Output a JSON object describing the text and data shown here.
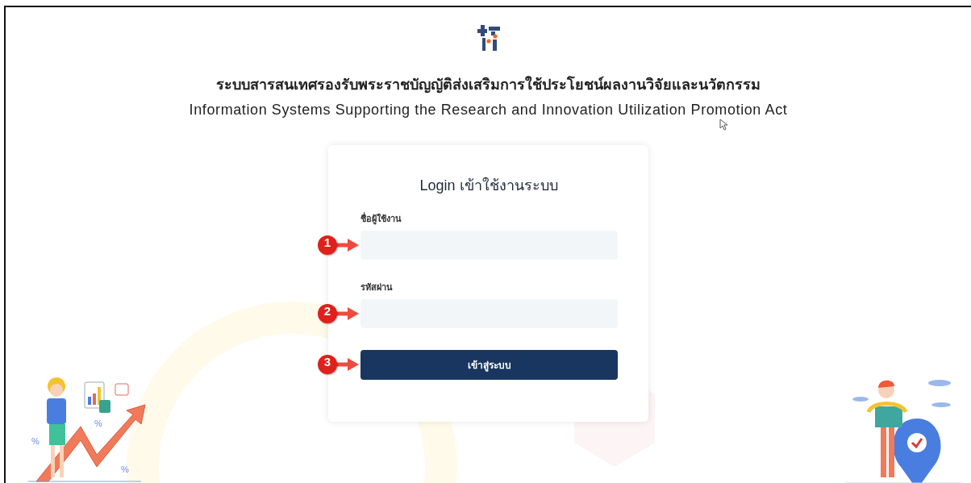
{
  "header": {
    "title_th": "ระบบสารสนเทศรองรับพระราชบัญญัติส่งเสริมการใช้ประโยชน์ผลงานวิจัยและนวัตกรรม",
    "title_en": "Information Systems Supporting the Research and Innovation Utilization Promotion Act"
  },
  "login_card": {
    "title": "Login เข้าใช้งานระบบ",
    "fields": [
      {
        "label": "ชื่อผู้ใช้งาน",
        "callout": "1"
      },
      {
        "label": "รหัสผ่าน",
        "callout": "2"
      }
    ],
    "submit": {
      "label": "เข้าสู่ระบบ",
      "callout": "3"
    }
  },
  "illustration": {
    "percent_signs": [
      "%",
      "%",
      "%"
    ]
  }
}
